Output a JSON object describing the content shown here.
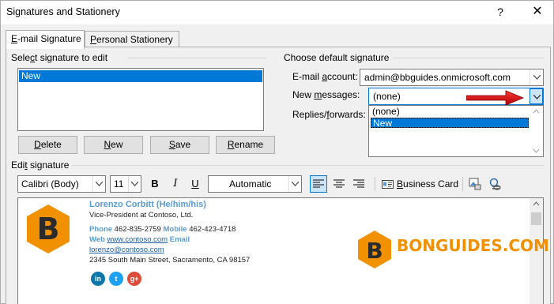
{
  "window": {
    "title": "Signatures and Stationery",
    "help_glyph": "?",
    "close_glyph": "✕"
  },
  "tabs": [
    {
      "accel": "E",
      "rest": "-mail Signature"
    },
    {
      "accel": "P",
      "rest": "ersonal Stationery"
    }
  ],
  "select_signature": {
    "label_pre": "Sele",
    "label_accel": "c",
    "label_post": "t signature to edit",
    "items": [
      "New"
    ],
    "selected": "New"
  },
  "buttons": {
    "delete": {
      "accel": "D",
      "rest": "elete"
    },
    "new": {
      "accel": "N",
      "rest": "ew"
    },
    "save": {
      "accel": "S",
      "rest": "ave"
    },
    "rename": {
      "accel": "R",
      "rest": "ename"
    }
  },
  "default_signature": {
    "group_label": "Choose default signature",
    "email_account_label_pre": "E-mail ",
    "email_account_accel": "a",
    "email_account_label_post": "ccount:",
    "email_account_value": "admin@bbguides.onmicrosoft.com",
    "new_messages_label_pre": "New ",
    "new_messages_accel": "m",
    "new_messages_label_post": "essages:",
    "new_messages_value": "(none)",
    "replies_label_pre": "Replies/",
    "replies_accel": "f",
    "replies_label_post": "orwards:",
    "dropdown_options": [
      "(none)",
      "New"
    ],
    "dropdown_selected": "New"
  },
  "edit_signature": {
    "label_pre": "Edi",
    "label_accel": "t",
    "label_post": " signature",
    "font": "Calibri (Body)",
    "size": "11",
    "bold": "B",
    "italic": "I",
    "underline": "U",
    "color": "Automatic",
    "business_card_accel": "B",
    "business_card_rest": "usiness Card"
  },
  "signature_content": {
    "name": "Lorenzo Corbitt (He/him/his)",
    "title": "Vice-President at Contoso, Ltd.",
    "phone_label": "Phone",
    "phone": "462-835-2759",
    "mobile_label": "Mobile",
    "mobile": "462-423-4718",
    "web_label": "Web",
    "web": "www.contoso.com",
    "email_label": "Email",
    "email": "lorenzo@contoso.com",
    "address": "2345 South Main Street, Sacramento, CA 98157",
    "logo_letter": "B",
    "social": [
      {
        "icon": "linkedin-icon",
        "glyph": "in",
        "color": "#0e76a8"
      },
      {
        "icon": "twitter-icon",
        "glyph": "t",
        "color": "#1da1f2"
      },
      {
        "icon": "google-plus-icon",
        "glyph": "g+",
        "color": "#dd4b39"
      }
    ]
  },
  "watermark": {
    "text": "BONGUIDES.COM",
    "letter": "B"
  },
  "colors": {
    "accent": "#0078d7",
    "brand_orange": "#f29100",
    "link_blue": "#5b9bd5"
  }
}
